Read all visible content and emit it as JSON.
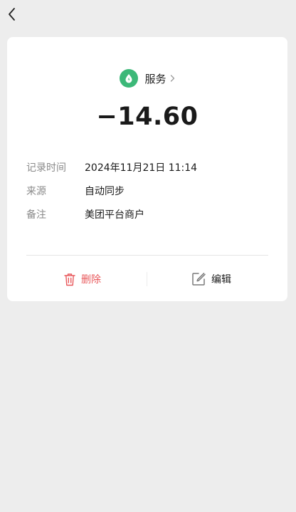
{
  "header": {
    "back_icon": "chevron-left-icon"
  },
  "record": {
    "category_icon": "leaf-drop-icon",
    "category": "服务",
    "category_color": "#3cb878",
    "amount": "−14.60",
    "fields": [
      {
        "key": "记录时间",
        "value": "2024年11月21日 11:14"
      },
      {
        "key": "来源",
        "value": "自动同步"
      },
      {
        "key": "备注",
        "value": "美团平台商户"
      }
    ]
  },
  "actions": {
    "delete_label": "删除",
    "delete_color": "#e8585b",
    "delete_icon": "trash-icon",
    "edit_label": "编辑",
    "edit_icon": "edit-icon"
  }
}
